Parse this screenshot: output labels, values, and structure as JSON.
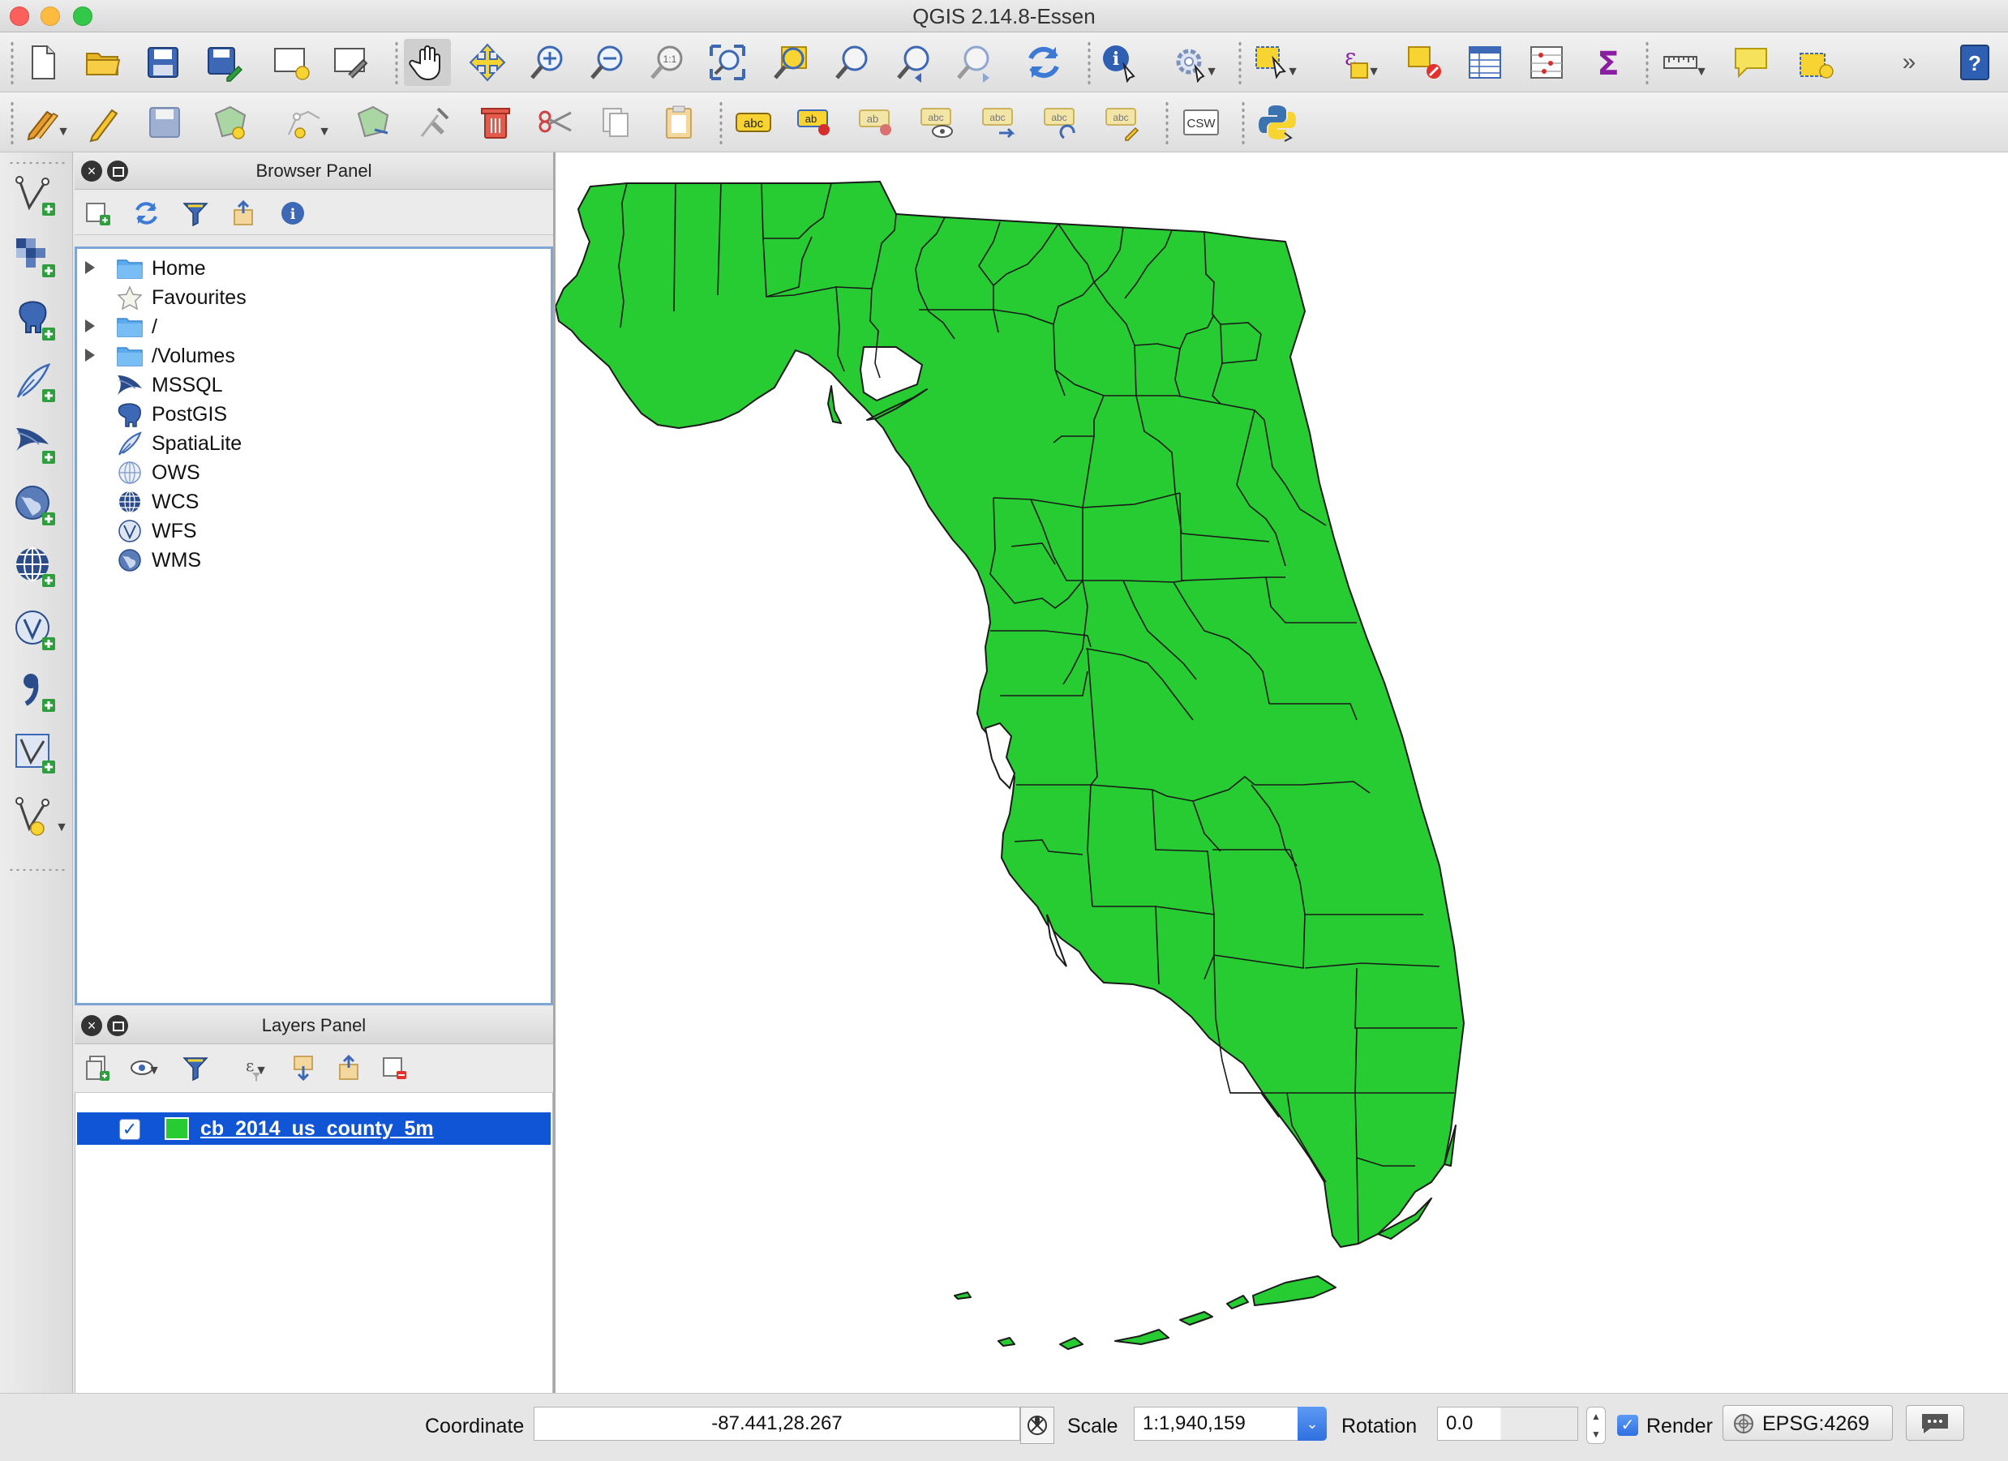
{
  "window": {
    "title": "QGIS 2.14.8-Essen"
  },
  "browser_panel": {
    "title": "Browser Panel",
    "items": [
      {
        "label": "Home",
        "icon": "folder-icon",
        "expandable": true
      },
      {
        "label": "Favourites",
        "icon": "star-icon",
        "expandable": false
      },
      {
        "label": "/",
        "icon": "folder-icon",
        "expandable": true
      },
      {
        "label": "/Volumes",
        "icon": "folder-icon",
        "expandable": true
      },
      {
        "label": "MSSQL",
        "icon": "mssql-icon",
        "expandable": false
      },
      {
        "label": "PostGIS",
        "icon": "postgis-elephant-icon",
        "expandable": false
      },
      {
        "label": "SpatiaLite",
        "icon": "spatialite-feather-icon",
        "expandable": false
      },
      {
        "label": "OWS",
        "icon": "ows-globe-icon",
        "expandable": false
      },
      {
        "label": "WCS",
        "icon": "wcs-globe-icon",
        "expandable": false
      },
      {
        "label": "WFS",
        "icon": "wfs-globe-icon",
        "expandable": false
      },
      {
        "label": "WMS",
        "icon": "wms-globe-icon",
        "expandable": false
      }
    ]
  },
  "layers_panel": {
    "title": "Layers Panel",
    "layers": [
      {
        "name": "cb_2014_us_county_5m",
        "visible": true,
        "color": "#26cc32"
      }
    ]
  },
  "map": {
    "fill_color": "#26cc32",
    "stroke_color": "#1a1a1a"
  },
  "statusbar": {
    "coordinate_label": "Coordinate",
    "coordinate_value": "-87.441,28.267",
    "scale_label": "Scale",
    "scale_value": "1:1,940,159",
    "rotation_label": "Rotation",
    "rotation_value": "0.0",
    "render_label": "Render",
    "render_checked": true,
    "crs_label": "EPSG:4269"
  }
}
